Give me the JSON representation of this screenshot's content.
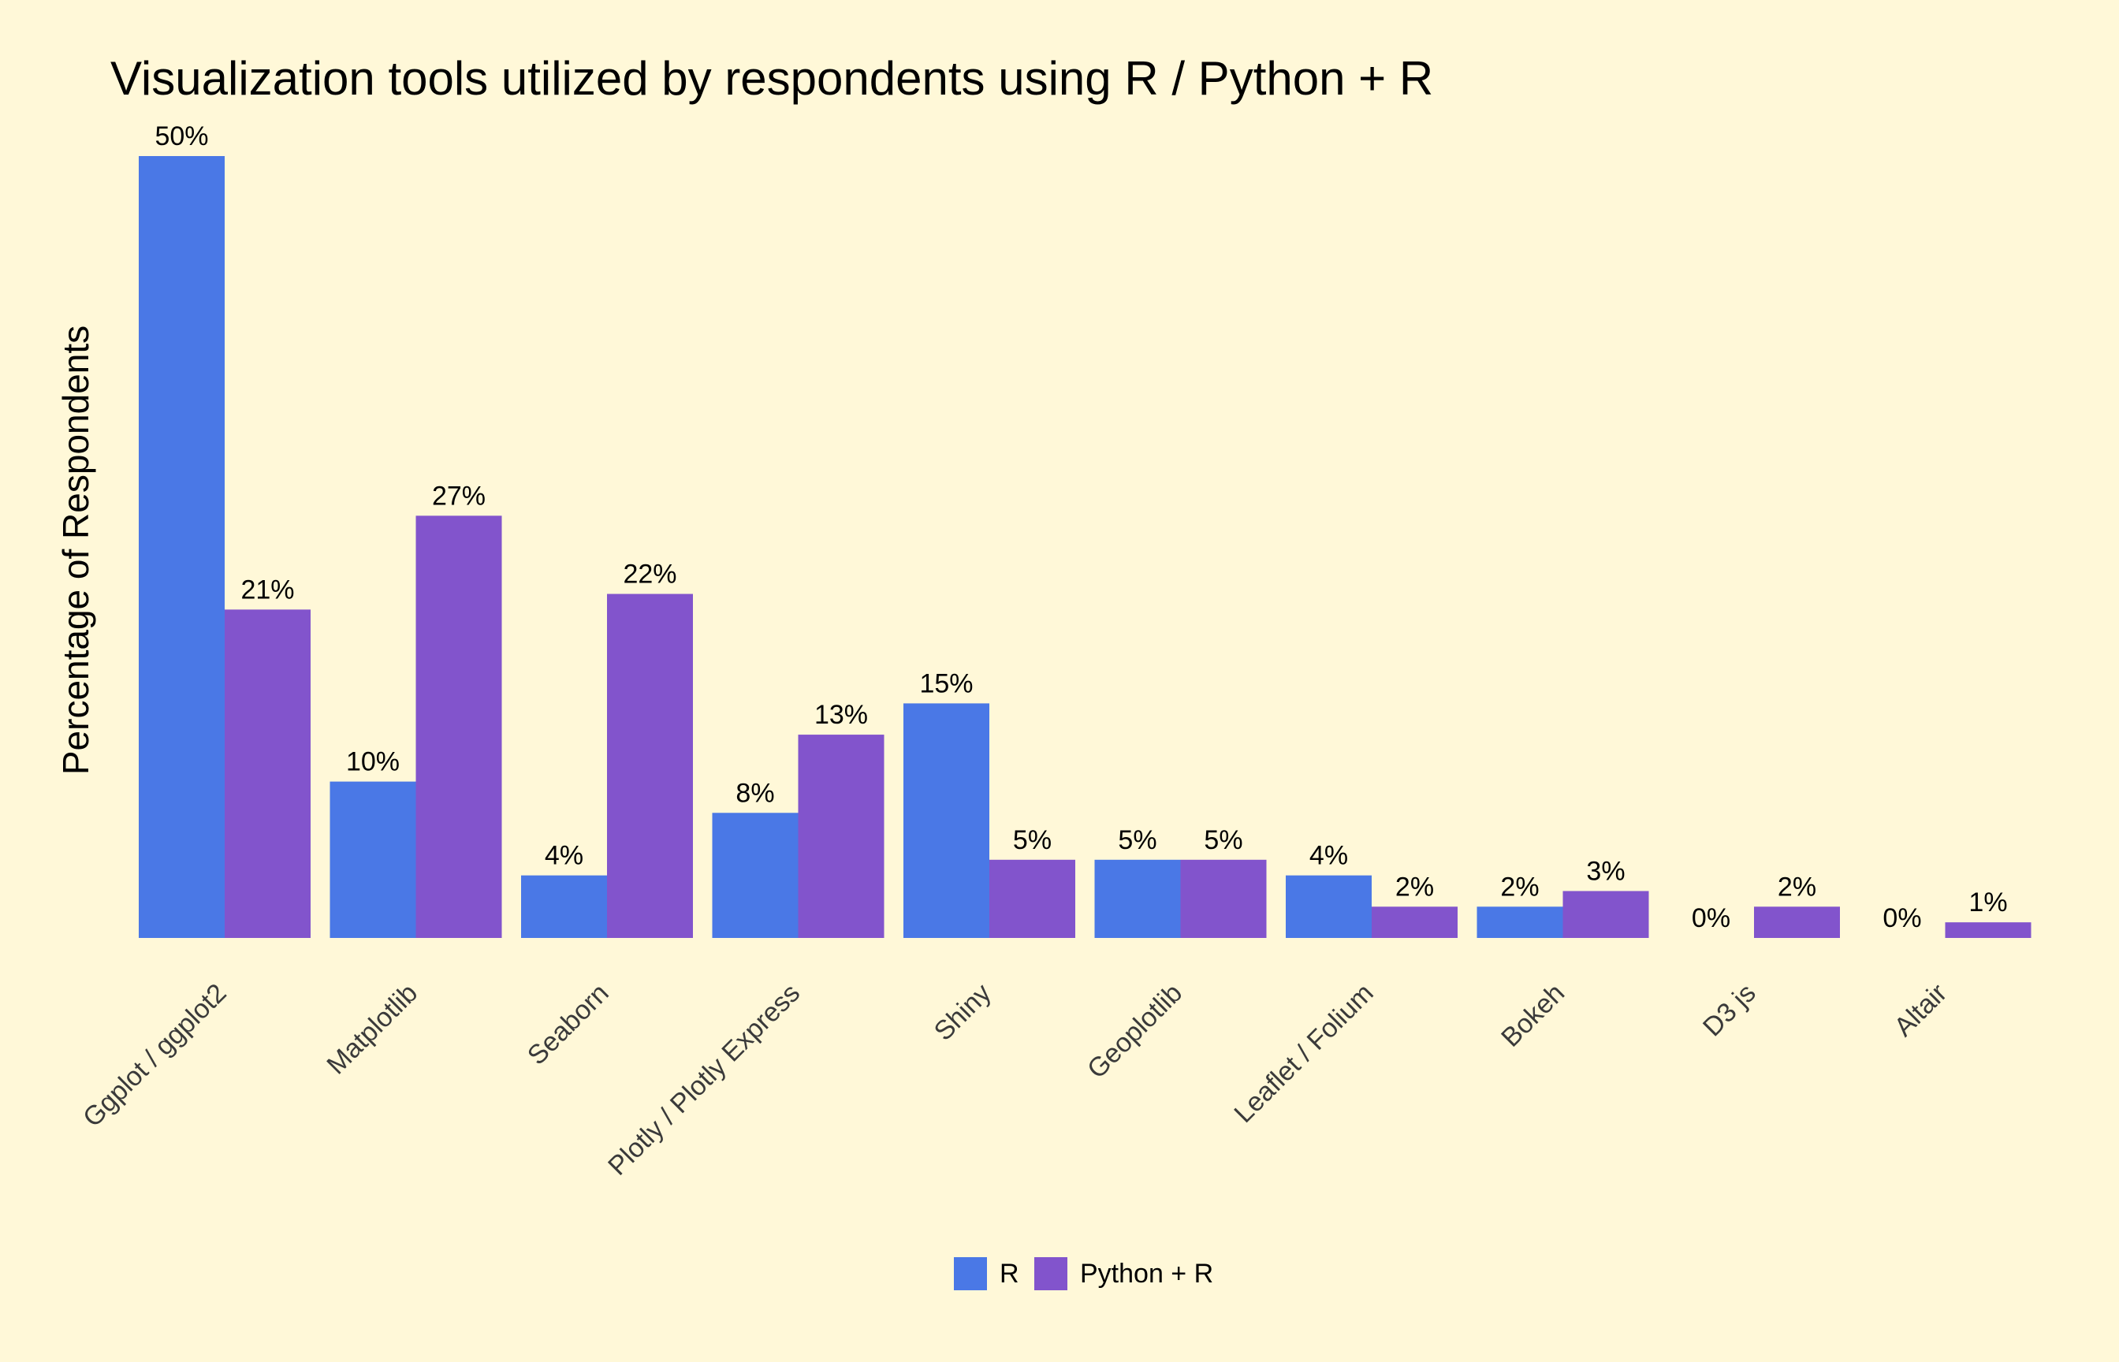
{
  "chart_data": {
    "type": "bar",
    "title": "Visualization tools utilized by respondents using R / Python + R",
    "ylabel": "Percentage of Respondents",
    "xlabel": "",
    "ylim": [
      0,
      50
    ],
    "grid": false,
    "legend_position": "bottom",
    "categories": [
      "Ggplot / ggplot2",
      "Matplotlib",
      "Seaborn",
      "Plotly / Plotly Express",
      "Shiny",
      "Geoplotlib",
      "Leaflet / Folium",
      "Bokeh",
      "D3 js",
      "Altair"
    ],
    "series": [
      {
        "name": "R",
        "color": "#4A78E6",
        "values": [
          50,
          10,
          4,
          8,
          15,
          5,
          4,
          2,
          0,
          0
        ],
        "labels": [
          "50%",
          "10%",
          "4%",
          "8%",
          "15%",
          "5%",
          "4%",
          "2%",
          "0%",
          "0%"
        ]
      },
      {
        "name": "Python + R",
        "color": "#8254CC",
        "values": [
          21,
          27,
          22,
          13,
          5,
          5,
          2,
          3,
          2,
          1
        ],
        "labels": [
          "21%",
          "27%",
          "22%",
          "13%",
          "5%",
          "5%",
          "2%",
          "3%",
          "2%",
          "1%"
        ]
      }
    ]
  }
}
